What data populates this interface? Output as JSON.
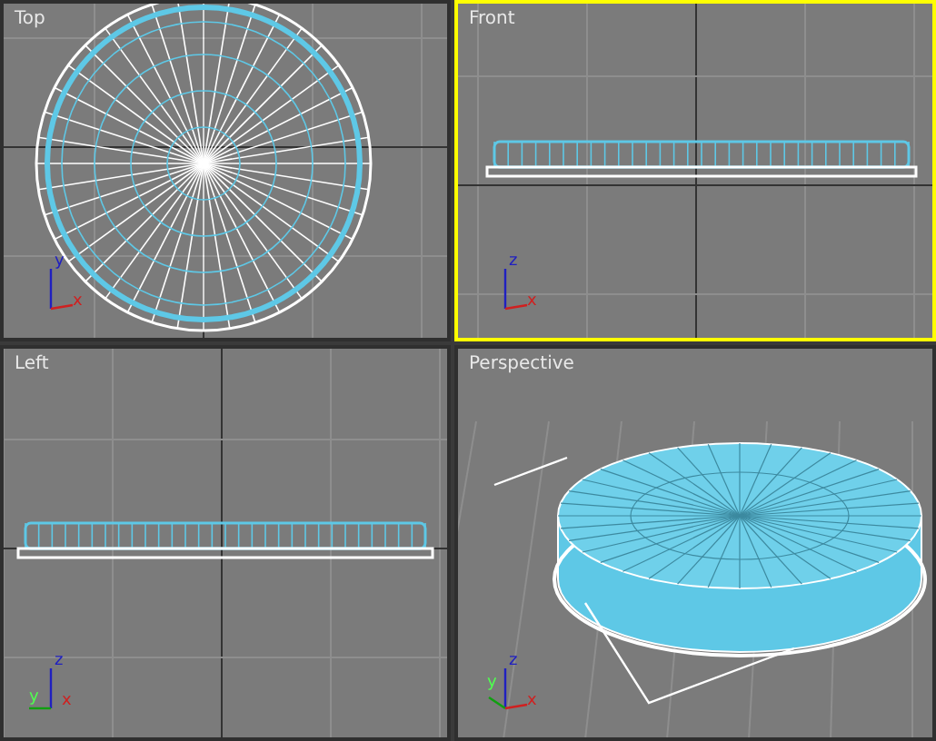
{
  "viewports": [
    {
      "label": "Top",
      "kind": "top",
      "active": false,
      "axes": [
        {
          "letter": "y",
          "kind": "up"
        },
        {
          "letter": "x",
          "kind": "right"
        }
      ]
    },
    {
      "label": "Front",
      "kind": "front",
      "active": true,
      "axes": [
        {
          "letter": "z",
          "kind": "up"
        },
        {
          "letter": "x",
          "kind": "right"
        }
      ]
    },
    {
      "label": "Left",
      "kind": "left",
      "active": false,
      "axes": [
        {
          "letter": "z",
          "kind": "up"
        },
        {
          "letter": "y",
          "kind": "left"
        },
        {
          "letter": "x",
          "kind": "origin"
        }
      ]
    },
    {
      "label": "Perspective",
      "kind": "perspective",
      "active": false,
      "axes": [
        {
          "letter": "z",
          "kind": "up"
        },
        {
          "letter": "y",
          "kind": "back"
        },
        {
          "letter": "x",
          "kind": "right"
        }
      ]
    }
  ]
}
